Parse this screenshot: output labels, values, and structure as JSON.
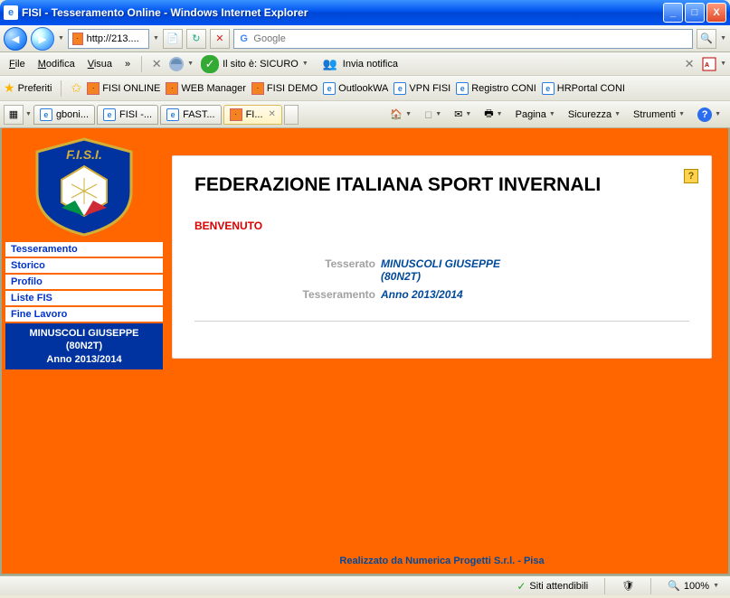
{
  "window": {
    "title": "FISI - Tesseramento Online - Windows Internet Explorer"
  },
  "nav": {
    "url": "http://213....",
    "search_placeholder": "Google"
  },
  "menu": {
    "file": "File",
    "modifica": "Modifica",
    "visua": "Visua",
    "sicuro_label": "Il sito è: SICURO",
    "invia_notifica": "Invia notifica"
  },
  "favorites": {
    "label": "Preferiti",
    "items": [
      "FISI ONLINE",
      "WEB Manager",
      "FISI DEMO",
      "OutlookWA",
      "VPN FISI",
      "Registro CONI",
      "HRPortal CONI"
    ]
  },
  "tabs": [
    {
      "label": "gboni..."
    },
    {
      "label": "FISI -..."
    },
    {
      "label": "FAST..."
    },
    {
      "label": "FI..."
    }
  ],
  "mainmenu": {
    "pagina": "Pagina",
    "sicurezza": "Sicurezza",
    "strumenti": "Strumenti"
  },
  "sidebar": {
    "items": [
      "Tesseramento",
      "Storico",
      "Profilo",
      "Liste FIS",
      "Fine Lavoro"
    ],
    "user_name": "MINUSCOLI GIUSEPPE",
    "user_code": "(80N2T)",
    "anno": "Anno 2013/2014"
  },
  "logo": {
    "text": "F.I.S.I."
  },
  "page": {
    "heading": "FEDERAZIONE ITALIANA SPORT INVERNALI",
    "welcome": "BENVENUTO",
    "tesserato_label": "Tesserato",
    "tesserato_name": "MINUSCOLI GIUSEPPE",
    "tesserato_code": "(80N2T)",
    "tesseramento_label": "Tesseramento",
    "tesseramento_value": "Anno 2013/2014",
    "footer": "Realizzato da Numerica Progetti S.r.l. - Pisa"
  },
  "status": {
    "trusted": "Siti attendibili",
    "zoom": "100%"
  }
}
